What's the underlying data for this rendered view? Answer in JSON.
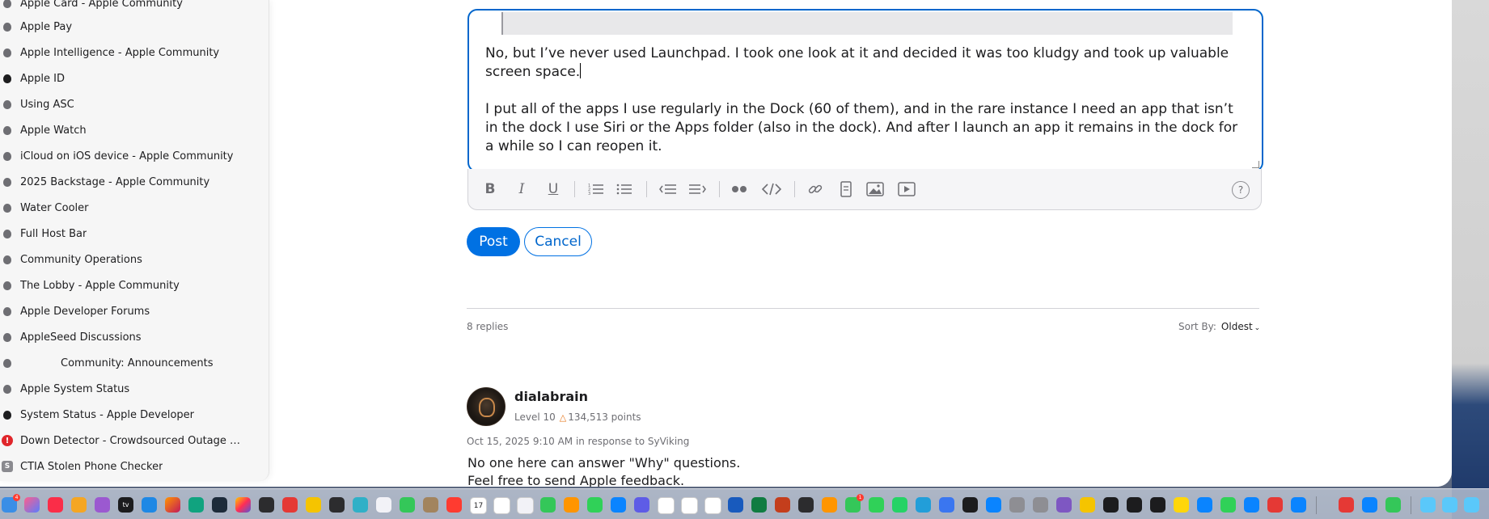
{
  "sidebar": {
    "items": [
      {
        "label": "Apple Card - Apple Community",
        "icon": "apple-icon"
      },
      {
        "label": "Apple Pay",
        "icon": "apple-icon"
      },
      {
        "label": "Apple Intelligence - Apple Community",
        "icon": "apple-icon"
      },
      {
        "label": "Apple ID",
        "icon": "apple-dark-icon"
      },
      {
        "label": "Using ASC",
        "icon": "apple-icon"
      },
      {
        "label": "Apple Watch",
        "icon": "apple-icon"
      },
      {
        "label": "iCloud on iOS device - Apple Community",
        "icon": "apple-icon"
      },
      {
        "label": "2025 Backstage - Apple Community",
        "icon": "apple-icon"
      },
      {
        "label": "Water Cooler",
        "icon": "apple-icon"
      },
      {
        "label": "Full Host Bar",
        "icon": "apple-icon"
      },
      {
        "label": "Community Operations",
        "icon": "apple-icon"
      },
      {
        "label": "The Lobby - Apple Community",
        "icon": "apple-icon"
      },
      {
        "label": "Apple Developer Forums",
        "icon": "apple-icon"
      },
      {
        "label": "AppleSeed Discussions",
        "icon": "apple-icon"
      },
      {
        "label": "Community: Announcements",
        "icon": "apple-icon"
      },
      {
        "label": "Apple System Status",
        "icon": "apple-icon"
      },
      {
        "label": "System Status - Apple Developer",
        "icon": "apple-dark-icon"
      },
      {
        "label": "Down Detector - Crowdsourced Outage Ch...",
        "icon": "alert-icon"
      },
      {
        "label": "CTIA Stolen Phone Checker",
        "icon": "s-icon"
      }
    ]
  },
  "editor": {
    "paragraph1": "No, but I’ve never used Launchpad. I took one look at it and decided it was too kludgy and took up valuable screen space.",
    "paragraph2": "I put all of the apps I use regularly in the Dock (60 of them), and in the rare instance I need an app that isn’t in the dock I use Siri or the Apps folder (also in the dock). And after I launch an app it remains in the dock for a while so I can reopen it.",
    "toolbar": {
      "bold": "B",
      "italic": "I",
      "underline": "U",
      "help": "?"
    }
  },
  "actions": {
    "post_label": "Post",
    "cancel_label": "Cancel"
  },
  "thread": {
    "replies_count": "8 replies",
    "sort_label": "Sort By:",
    "sort_value": "Oldest"
  },
  "reply": {
    "author": "dialabrain",
    "level": "Level 10",
    "points": "134,513 points",
    "timestamp": "Oct 15, 2025 9:10 AM in response to SyViking",
    "line1": "No one here can answer \"Why\" questions.",
    "line2": "Feel free to send Apple feedback."
  },
  "dock": {
    "badges": {
      "finder": "4",
      "messages": "1"
    },
    "calendar_day": "17"
  },
  "colors": {
    "accent": "#0071e3",
    "link": "#0066cc",
    "text": "#1d1d1f",
    "secondary": "#6e6e73"
  }
}
